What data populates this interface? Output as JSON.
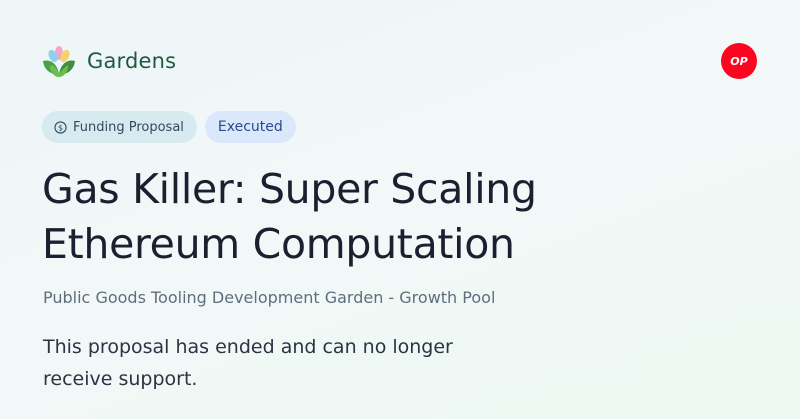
{
  "brand": {
    "name": "Gardens",
    "logo_icon": "gardens-flower-logo-icon"
  },
  "network": {
    "label": "OP",
    "icon": "optimism-network-icon",
    "color": "#ff0420"
  },
  "tags": {
    "type_label": "Funding Proposal",
    "type_icon": "dollar-coin-icon",
    "status_label": "Executed"
  },
  "proposal": {
    "title": "Gas Killer: Super Scaling Ethereum Computation",
    "pool": "Public Goods Tooling Development Garden - Growth Pool",
    "message": "This proposal has ended and can no longer receive support."
  },
  "colors": {
    "brand_text": "#1d5b3f",
    "type_tag_bg": "#d7eaf0",
    "status_tag_bg": "#dbe8fb"
  }
}
